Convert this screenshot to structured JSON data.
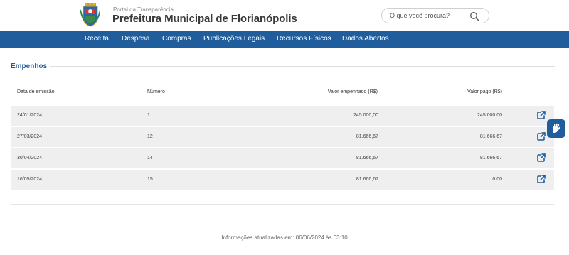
{
  "header": {
    "portal_subtitle": "Portal da Transparência",
    "site_title": "Prefeitura Municipal de Florianópolis",
    "search_placeholder": "O que você procura?"
  },
  "nav": {
    "items": [
      "Receita",
      "Despesa",
      "Compras",
      "Publicações Legais",
      "Recursos Físicos",
      "Dados Abertos"
    ]
  },
  "section": {
    "title": "Empenhos"
  },
  "table": {
    "columns": [
      "Data de emissão",
      "Número",
      "Valor empenhado (R$)",
      "Valor pago (R$)"
    ],
    "rows": [
      {
        "date": "24/01/2024",
        "number": "1",
        "committed": "245.000,00",
        "paid": "245.000,00"
      },
      {
        "date": "27/03/2024",
        "number": "12",
        "committed": "81.666,67",
        "paid": "81.666,67"
      },
      {
        "date": "30/04/2024",
        "number": "14",
        "committed": "81.666,67",
        "paid": "81.666,67"
      },
      {
        "date": "16/05/2024",
        "number": "15",
        "committed": "81.666,67",
        "paid": "0,00"
      }
    ]
  },
  "footer": {
    "updated_text": "Informações atualizadas em: 06/06/2024 às 03:10"
  },
  "icons": {
    "logo": "florianopolis-coat-of-arms",
    "search": "search-icon",
    "row_action": "external-link-icon",
    "accessibility": "sign-language-icon"
  },
  "colors": {
    "brand": "#1f5d9c",
    "row_bg": "#efefef"
  }
}
